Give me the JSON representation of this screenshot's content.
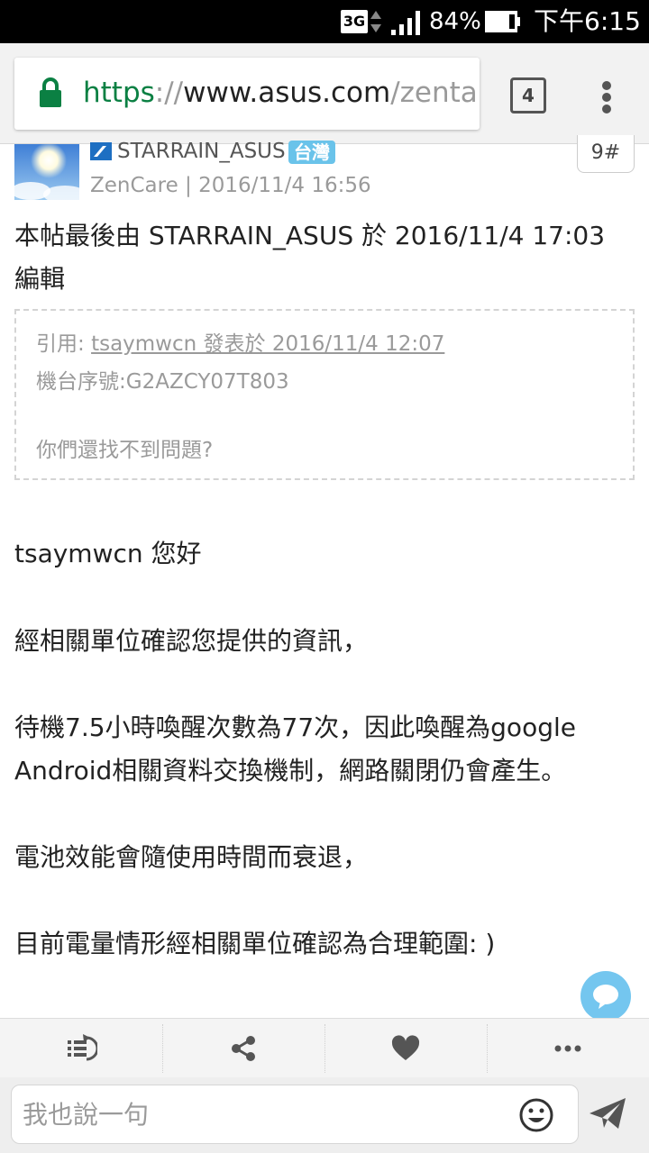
{
  "status_bar": {
    "network": "3G",
    "battery_percent": "84%",
    "time": "下午6:15"
  },
  "browser": {
    "url_scheme": "https",
    "url_separator": "://",
    "url_host": "www.asus.com",
    "url_path": "/zental",
    "tab_count": "4",
    "icons": {
      "lock": "lock-icon",
      "menu": "more-vert-icon"
    },
    "secure_color": "#0b8043"
  },
  "post": {
    "username": "STARRAIN_ASUS",
    "region_badge": "台灣",
    "meta": "ZenCare | 2016/11/4 16:56",
    "floor": "9#",
    "edit_note": "本帖最後由 STARRAIN_ASUS 於 2016/11/4 17:03 編輯",
    "quote": {
      "prefix": "引用: ",
      "author_line": "tsaymwcn 發表於 2016/11/4 12:07",
      "serial": "機台序號:G2AZCY07T803",
      "question": "你們還找不到問題?"
    },
    "paragraphs": [
      "tsaymwcn 您好",
      "經相關單位確認您提供的資訊，",
      "待機7.5小時喚醒次數為77次，因此喚醒為google Android相關資料交換機制，網路關閉仍會產生。",
      "電池效能會隨使用時間而衰退，",
      "目前電量情形經相關單位確認為合理範圍: )"
    ],
    "badge_color": "#6ac3ea"
  },
  "actions": {
    "icons": [
      "reply-list-icon",
      "share-icon",
      "heart-icon",
      "more-horiz-icon"
    ]
  },
  "comment": {
    "placeholder": "我也說一句",
    "icons": {
      "emoji": "smiley-icon",
      "send": "send-icon"
    }
  }
}
